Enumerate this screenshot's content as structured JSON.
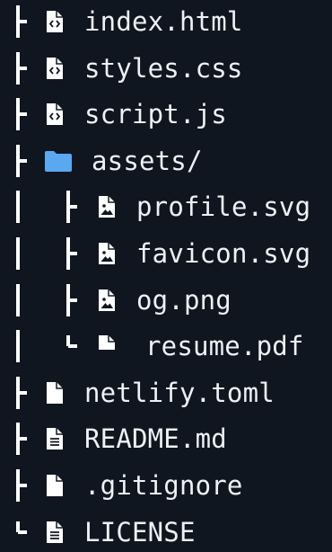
{
  "file_tree": [
    {
      "label": "index.html",
      "icon": "code-file-icon",
      "depth": 0,
      "last": false
    },
    {
      "label": "styles.css",
      "icon": "code-file-icon",
      "depth": 0,
      "last": false
    },
    {
      "label": "script.js",
      "icon": "code-file-icon",
      "depth": 0,
      "last": false
    },
    {
      "label": "assets/",
      "icon": "folder-icon",
      "depth": 0,
      "last": false
    },
    {
      "label": "profile.svg",
      "icon": "image-file-icon",
      "depth": 1,
      "last": false
    },
    {
      "label": "favicon.svg",
      "icon": "image-file-icon",
      "depth": 1,
      "last": false
    },
    {
      "label": "og.png",
      "icon": "image-file-icon",
      "depth": 1,
      "last": false
    },
    {
      "label": "resume.pdf",
      "icon": "pdf-file-icon",
      "depth": 1,
      "last": true
    },
    {
      "label": "netlify.toml",
      "icon": "file-icon",
      "depth": 0,
      "last": false
    },
    {
      "label": "README.md",
      "icon": "text-file-icon",
      "depth": 0,
      "last": false
    },
    {
      "label": ".gitignore",
      "icon": "file-icon",
      "depth": 0,
      "last": false
    },
    {
      "label": "LICENSE",
      "icon": "text-file-icon",
      "depth": 0,
      "last": true
    }
  ],
  "colors": {
    "background": "#101620",
    "text": "#eef1f5",
    "tree_lines": "#ffffff",
    "folder": "#5aa9f0",
    "file_icon": "#ffffff"
  }
}
